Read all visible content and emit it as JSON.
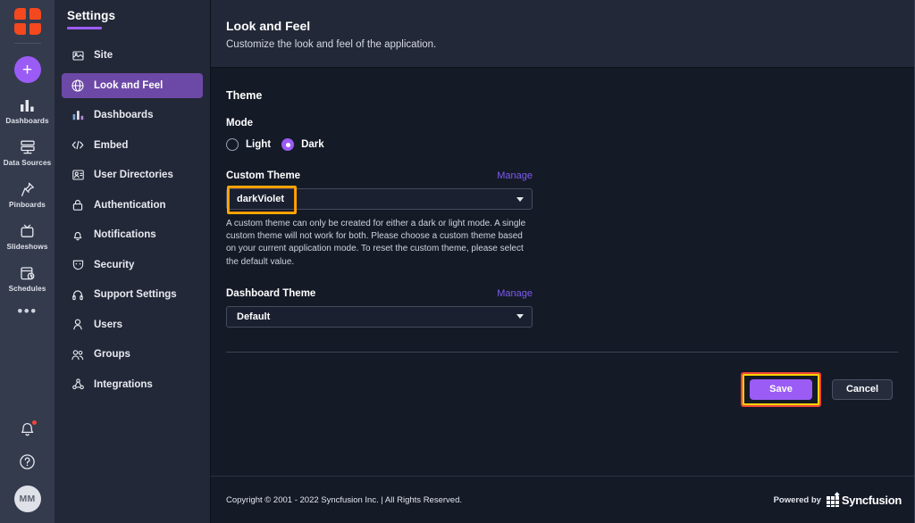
{
  "rail": {
    "logo_icon": "app-logo-icon",
    "add_button_label": "+",
    "items": [
      {
        "label": "Dashboards",
        "icon": "dashboards-icon"
      },
      {
        "label": "Data Sources",
        "icon": "data-sources-icon"
      },
      {
        "label": "Pinboards",
        "icon": "pinboards-icon"
      },
      {
        "label": "Slideshows",
        "icon": "slideshows-icon"
      },
      {
        "label": "Schedules",
        "icon": "schedules-icon"
      }
    ],
    "more_label": "•••",
    "notifications_icon": "bell-icon",
    "help_icon": "help-circle-icon",
    "avatar_initials": "MM"
  },
  "nav": {
    "title": "Settings",
    "items": [
      {
        "label": "Site",
        "icon": "site-icon",
        "active": false
      },
      {
        "label": "Look and Feel",
        "icon": "look-and-feel-icon",
        "active": true
      },
      {
        "label": "Dashboards",
        "icon": "dashboards-icon",
        "active": false
      },
      {
        "label": "Embed",
        "icon": "embed-code-icon",
        "active": false
      },
      {
        "label": "User Directories",
        "icon": "user-directories-icon",
        "active": false
      },
      {
        "label": "Authentication",
        "icon": "lock-icon",
        "active": false
      },
      {
        "label": "Notifications",
        "icon": "bell-icon",
        "active": false
      },
      {
        "label": "Security",
        "icon": "shield-icon",
        "active": false
      },
      {
        "label": "Support Settings",
        "icon": "headset-icon",
        "active": false
      },
      {
        "label": "Users",
        "icon": "user-icon",
        "active": false
      },
      {
        "label": "Groups",
        "icon": "users-group-icon",
        "active": false
      },
      {
        "label": "Integrations",
        "icon": "integrations-icon",
        "active": false
      }
    ]
  },
  "page": {
    "title": "Look and Feel",
    "subtitle": "Customize the look and feel of the application."
  },
  "theme": {
    "section_title": "Theme",
    "mode_label": "Mode",
    "mode_options": [
      {
        "label": "Light",
        "selected": false
      },
      {
        "label": "Dark",
        "selected": true
      }
    ],
    "custom_theme_label": "Custom Theme",
    "custom_theme_manage": "Manage",
    "custom_theme_value": "darkViolet",
    "custom_theme_helper": "A custom theme can only be created for either a dark or light mode. A single custom theme will not work for both. Please choose a custom theme based on your current application mode. To reset the custom theme, please select the default value.",
    "dashboard_theme_label": "Dashboard Theme",
    "dashboard_theme_manage": "Manage",
    "dashboard_theme_value": "Default"
  },
  "actions": {
    "save_label": "Save",
    "cancel_label": "Cancel"
  },
  "footer": {
    "copyright": "Copyright © 2001 - 2022 Syncfusion Inc. | All Rights Reserved.",
    "powered_by": "Powered by",
    "brand": "Syncfusion",
    "brand_icon": "syncfusion-logo-icon"
  },
  "colors": {
    "accent_purple": "#9b5cf6",
    "active_nav": "#6c49a6",
    "logo_orange": "#f4481f",
    "link_purple": "#7c5cf0",
    "highlight_orange": "#ffaa00",
    "highlight_red": "#f04438",
    "highlight_yellow": "#ffd400",
    "notification_dot": "#f04438"
  }
}
